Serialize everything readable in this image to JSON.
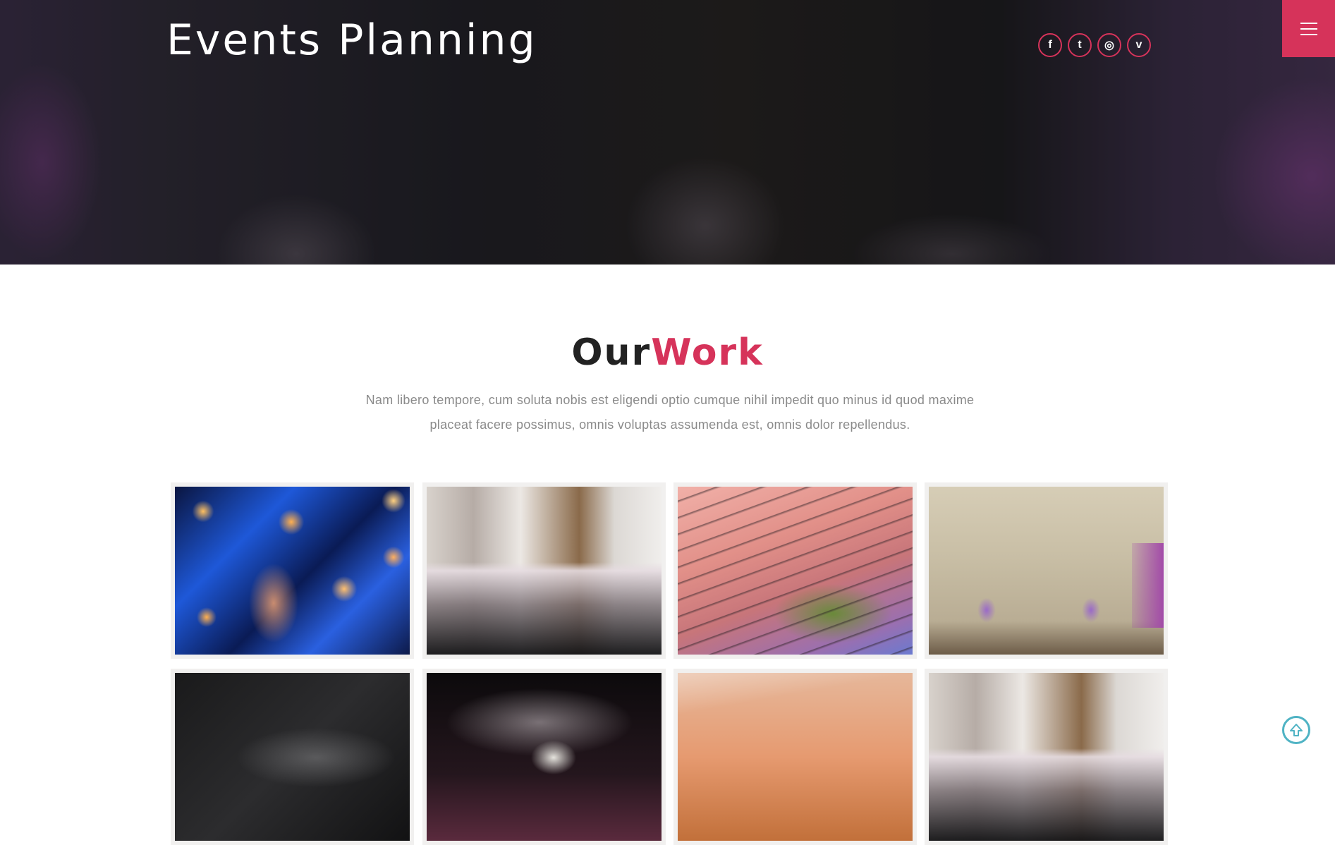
{
  "header": {
    "site_title": "Events Planning",
    "social_links": [
      {
        "icon": "facebook-icon",
        "glyph": "f"
      },
      {
        "icon": "twitter-icon",
        "glyph": "t"
      },
      {
        "icon": "dribbble-icon",
        "glyph": "◎"
      },
      {
        "icon": "vimeo-icon",
        "glyph": "v"
      }
    ],
    "menu_icon": "hamburger-menu-icon"
  },
  "work_section": {
    "title_part1": "Our",
    "title_part2": "Work",
    "description": "Nam libero tempore, cum soluta nobis est eligendi optio cumque nihil impedit quo minus id quod maxime placeat facere possimus, omnis voluptas assumenda est, omnis dolor repellendus."
  },
  "gallery": [
    {
      "subject": "blurred stage lights"
    },
    {
      "subject": "banquet tables"
    },
    {
      "subject": "stage lighting truss"
    },
    {
      "subject": "room with balloons"
    },
    {
      "subject": "dark table setting"
    },
    {
      "subject": "ring close-up"
    },
    {
      "subject": "warm sunset ceiling"
    },
    {
      "subject": "banquet tables"
    }
  ],
  "scroll_top_icon": "arrow-up-circle-icon",
  "colors": {
    "accent": "#d6335a",
    "title_dark": "#222222",
    "body_text": "#8a8a8a",
    "scroll_top": "#4fb3c4"
  }
}
